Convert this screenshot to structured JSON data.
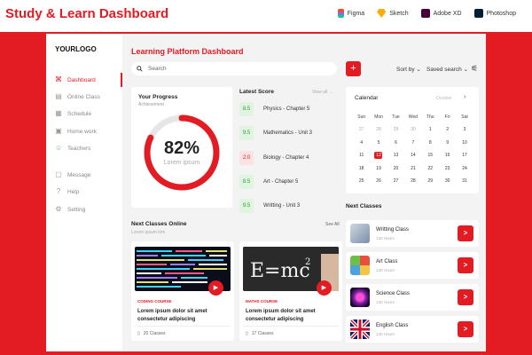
{
  "header": {
    "title": "Study & Learn Dashboard",
    "tools": [
      {
        "name": "Figma",
        "icon": "figma-icon"
      },
      {
        "name": "Sketch",
        "icon": "sketch-icon"
      },
      {
        "name": "Adobe XD",
        "icon": "xd-icon"
      },
      {
        "name": "Photoshop",
        "icon": "photoshop-icon"
      }
    ]
  },
  "colors": {
    "accent": "#e31b23",
    "background": "#f3f3f3"
  },
  "sidebar": {
    "logo": "YOURLOGO",
    "items": [
      {
        "label": "Dashboard",
        "icon": "command-icon"
      },
      {
        "label": "Online Class",
        "icon": "document-icon"
      },
      {
        "label": "Schedule",
        "icon": "calendar-icon"
      },
      {
        "label": "Home work",
        "icon": "homework-icon"
      },
      {
        "label": "Teachers",
        "icon": "teachers-icon"
      },
      {
        "label": "Message",
        "icon": "message-icon"
      },
      {
        "label": "Help",
        "icon": "help-icon"
      },
      {
        "label": "Setting",
        "icon": "gear-icon"
      }
    ]
  },
  "main": {
    "title": "Learning Platform Dashboard",
    "search_placeholder": "Search",
    "add_label": "+",
    "sort_label": "Sort by",
    "saved_label": "Saved search"
  },
  "progress": {
    "title": "Your Progress",
    "subtitle": "Achievement",
    "percent_text": "82%",
    "percent_value": 0.82,
    "caption": "Lorem ipsum"
  },
  "scores": {
    "title": "Latest Score",
    "view_all": "View all",
    "items": [
      {
        "score": "8.5",
        "subject": "Physics - Chapter 5",
        "status": "good"
      },
      {
        "score": "9.5",
        "subject": "Mathematics - Unit 3",
        "status": "good"
      },
      {
        "score": "2.0",
        "subject": "Biology - Chapter 4",
        "status": "bad"
      },
      {
        "score": "8.5",
        "subject": "Art - Chapter 5",
        "status": "good"
      },
      {
        "score": "9.5",
        "subject": "Writting - Unit 3",
        "status": "good"
      }
    ]
  },
  "calendar": {
    "title": "Calendar",
    "month": "October",
    "days": [
      "Sun",
      "Mon",
      "Tue",
      "Wed",
      "Thu",
      "Fri",
      "Sat"
    ],
    "weeks": [
      [
        "27",
        "28",
        "29",
        "30",
        "1",
        "2",
        "3"
      ],
      [
        "4",
        "5",
        "6",
        "7",
        "8",
        "9",
        "10"
      ],
      [
        "11",
        "12",
        "13",
        "14",
        "15",
        "16",
        "17"
      ],
      [
        "18",
        "19",
        "20",
        "21",
        "22",
        "23",
        "24"
      ],
      [
        "25",
        "26",
        "27",
        "28",
        "29",
        "30",
        "31"
      ]
    ],
    "today": "12"
  },
  "online_classes": {
    "title": "Next Classes Online",
    "subtitle": "Lorem ipsum lom",
    "see_all": "See All",
    "cards": [
      {
        "category": "CODING COURSE",
        "description": "Lorem ipsum dolor sit amet consectetur adipiscing",
        "classes": "20 Classes"
      },
      {
        "category": "MATHS COURSE",
        "description": "Lorem ipsum dolor sit amet consectetur adipiscing",
        "classes": "17 Classes"
      }
    ]
  },
  "next_classes": {
    "title": "Next Classes",
    "items": [
      {
        "name": "Writting Class",
        "hours": "130 Hours"
      },
      {
        "name": "Art Class",
        "hours": "130 Hours"
      },
      {
        "name": "Science Class",
        "hours": "130 Hours"
      },
      {
        "name": "English Class",
        "hours": "130 Hours"
      }
    ],
    "go_label": ">"
  }
}
